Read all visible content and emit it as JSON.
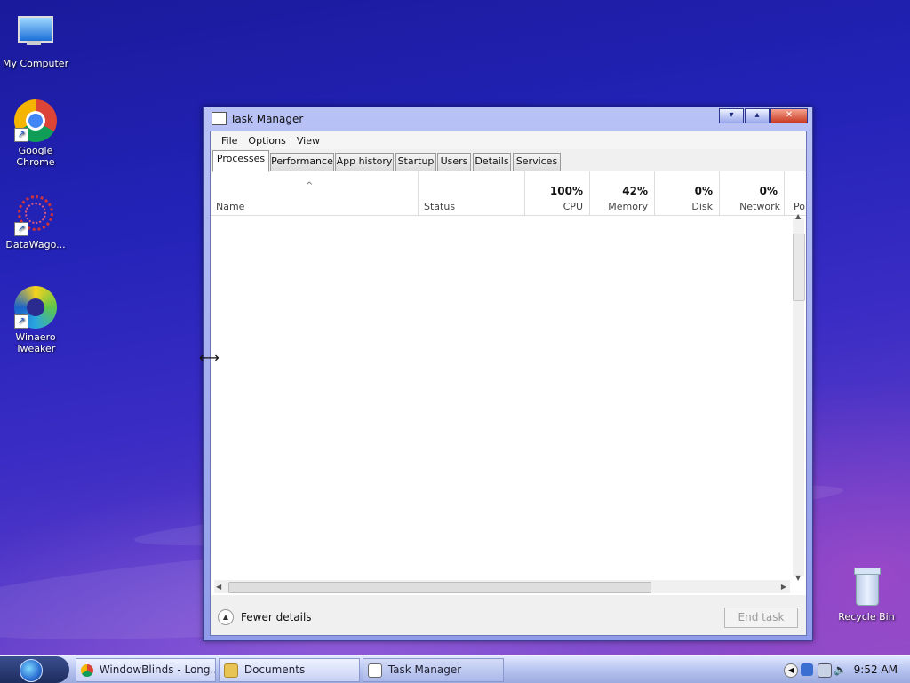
{
  "desktop": {
    "icons": [
      {
        "label": "My Computer"
      },
      {
        "label": "Google Chrome"
      },
      {
        "label": "DataWago..."
      },
      {
        "label": "Winaero Tweaker"
      },
      {
        "label": "Recycle Bin"
      }
    ]
  },
  "window": {
    "title": "Task Manager",
    "buttons": {
      "minimize": "▾",
      "maximize": "▴",
      "close": "✕"
    }
  },
  "menu": {
    "file": "File",
    "options": "Options",
    "view": "View"
  },
  "tabs": [
    {
      "label": "Processes"
    },
    {
      "label": "Performance"
    },
    {
      "label": "App history"
    },
    {
      "label": "Startup"
    },
    {
      "label": "Users"
    },
    {
      "label": "Details"
    },
    {
      "label": "Services"
    }
  ],
  "columns": {
    "name": "Name",
    "status": "Status",
    "cpu": {
      "pct": "100%",
      "label": "CPU"
    },
    "memory": {
      "pct": "42%",
      "label": "Memory"
    },
    "disk": {
      "pct": "0%",
      "label": "Disk"
    },
    "network": {
      "pct": "0%",
      "label": "Network"
    },
    "power": "Po"
  },
  "footer": {
    "fewer_details": "Fewer details",
    "end_task": "End task"
  },
  "taskbar": {
    "items": [
      {
        "label": "WindowBlinds - Long..."
      },
      {
        "label": "Documents"
      },
      {
        "label": "Task Manager"
      }
    ],
    "clock": "9:52 AM"
  },
  "colors": {
    "accent": "#2323b8",
    "titlebar": "#b9c2f5",
    "close": "#c83a22"
  }
}
